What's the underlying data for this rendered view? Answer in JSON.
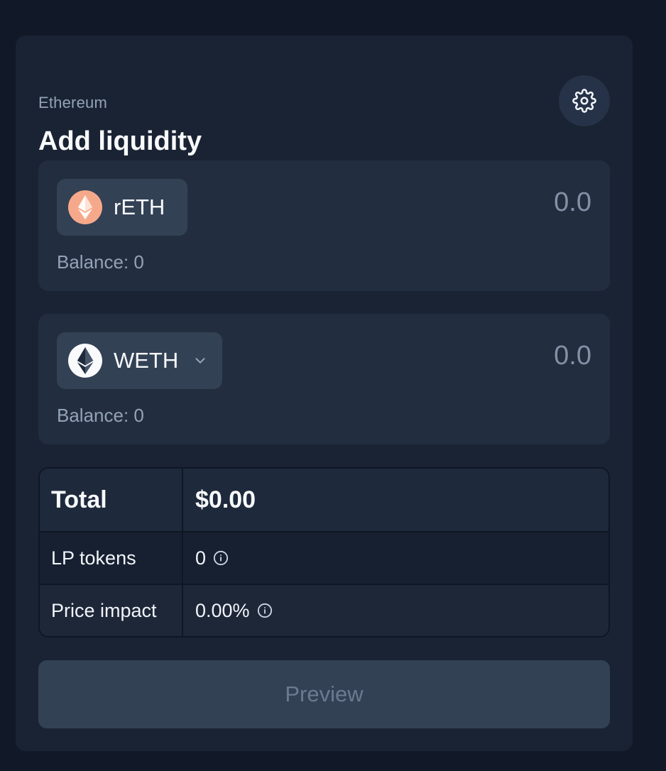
{
  "header": {
    "network": "Ethereum",
    "title": "Add liquidity"
  },
  "tokens": [
    {
      "symbol": "rETH",
      "amount_placeholder": "0.0",
      "balance": "Balance: 0",
      "icon": "reth-token-icon",
      "icon_bg": "#f6a98a",
      "has_dropdown": false
    },
    {
      "symbol": "WETH",
      "amount_placeholder": "0.0",
      "balance": "Balance: 0",
      "icon": "weth-token-icon",
      "icon_bg": "#f8fafc",
      "has_dropdown": true
    }
  ],
  "summary": {
    "total_label": "Total",
    "total_value": "$0.00",
    "lp_label": "LP tokens",
    "lp_value": "0",
    "impact_label": "Price impact",
    "impact_value": "0.00%"
  },
  "actions": {
    "preview_label": "Preview"
  },
  "colors": {
    "page_bg": "#111827",
    "card_bg": "#1a2333",
    "panel_bg": "#222d3f",
    "pill_bg": "#334155",
    "muted_text": "#94a3b8"
  }
}
